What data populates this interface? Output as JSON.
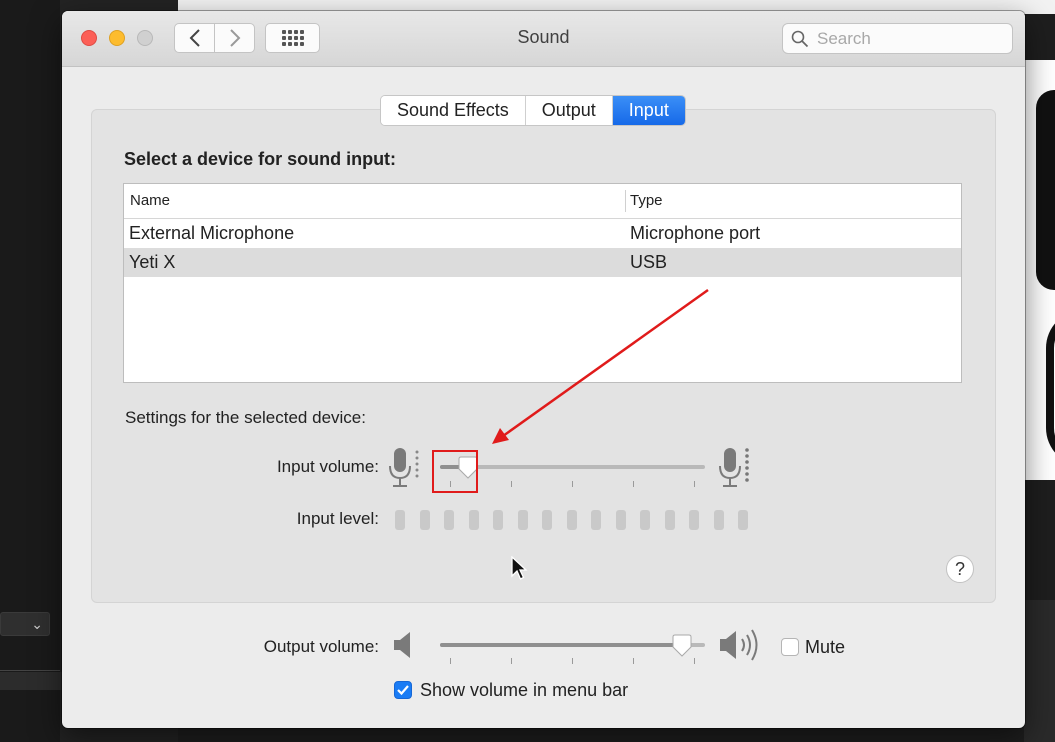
{
  "window": {
    "title": "Sound",
    "search_placeholder": "Search"
  },
  "tabs": [
    {
      "label": "Sound Effects",
      "active": false
    },
    {
      "label": "Output",
      "active": false
    },
    {
      "label": "Input",
      "active": true
    }
  ],
  "input": {
    "section_heading": "Select a device for sound input:",
    "columns": {
      "name": "Name",
      "type": "Type"
    },
    "devices": [
      {
        "name": "External Microphone",
        "type": "Microphone port",
        "selected": false
      },
      {
        "name": "Yeti X",
        "type": "USB",
        "selected": true
      }
    ],
    "settings_heading": "Settings for the selected device:",
    "input_volume_label": "Input volume:",
    "input_volume_value": 0.07,
    "input_level_label": "Input level:",
    "input_level_segments": 15
  },
  "output": {
    "output_volume_label": "Output volume:",
    "output_volume_value": 0.95,
    "mute_label": "Mute",
    "mute_checked": false,
    "show_volume_label": "Show volume in menu bar",
    "show_volume_checked": true
  },
  "colors": {
    "accent": "#1a7cf5",
    "annotation": "#e01b1b"
  },
  "icons": [
    "back-chevron-icon",
    "forward-chevron-icon",
    "show-all-grid-icon",
    "search-icon",
    "microphone-low-icon",
    "microphone-high-icon",
    "speaker-low-icon",
    "speaker-high-icon",
    "help-icon",
    "checkmark-icon",
    "mouse-pointer-icon"
  ]
}
